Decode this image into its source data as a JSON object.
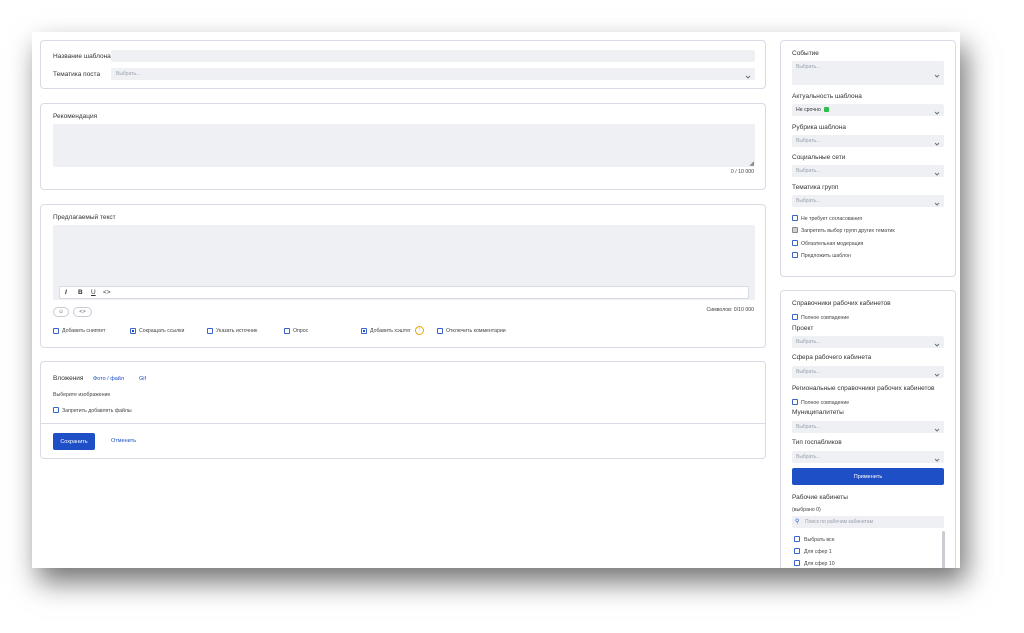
{
  "template": {
    "name_label": "Название шаблона",
    "topic_label": "Тематика поста",
    "topic_placeholder": "Выбрать..."
  },
  "recommendation": {
    "label": "Рекомендация",
    "counter": "0 / 10 000"
  },
  "proposed": {
    "label": "Предлагаемый текст",
    "toolbar": {
      "italic": "I",
      "bold": "B",
      "underline": "U",
      "code": "<>"
    },
    "emoji_btn": "☺",
    "code_btn": "<>",
    "counter": "Символов: 0/10 000",
    "options": [
      {
        "label": "Добавить сниппет",
        "checked": false
      },
      {
        "label": "Сокращать ссылки",
        "checked": true
      },
      {
        "label": "Указать источник",
        "checked": false
      },
      {
        "label": "Опрос",
        "checked": false
      },
      {
        "label": "Добавить хэштег",
        "checked": true
      },
      {
        "label": "Отключить комментарии",
        "checked": false
      }
    ]
  },
  "attachments": {
    "label": "Вложения",
    "photo_link": "Фото / файл",
    "gif_link": "Gif",
    "choose_image": "Выберите изображение",
    "forbid_files": "Запретить добавлять файлы",
    "save": "Сохранить",
    "cancel": "Отменить"
  },
  "right_top": {
    "event_label": "Событие",
    "event_placeholder": "Выбрать...",
    "actuality_label": "Актуальность шаблона",
    "actuality_value": "Не срочно",
    "actuality_color": "#2fbf4a",
    "rubric_label": "Рубрика шаблона",
    "rubric_placeholder": "Выбрать...",
    "social_label": "Социальные сети",
    "social_placeholder": "Выбрать...",
    "groups_label": "Тематика групп",
    "groups_placeholder": "Выбрать...",
    "checks": [
      {
        "label": "Не требует согласования",
        "state": "off"
      },
      {
        "label": "Запретить выбор групп других тематик",
        "state": "grey"
      },
      {
        "label": "Обязательная модерация",
        "state": "off"
      },
      {
        "label": "Предложить шаблон",
        "state": "off"
      }
    ]
  },
  "right_bottom": {
    "title": "Справочники рабочих кабинетов",
    "full_match": "Полное совпадение",
    "project_label": "Проект",
    "project_placeholder": "Выбрать...",
    "sphere_label": "Сфера рабочего кабинета",
    "sphere_placeholder": "Выбрать...",
    "regional_label": "Региональные справочники рабочих кабинетов",
    "full_match2": "Полное совпадение",
    "municipal_label": "Муниципалитеты",
    "municipal_placeholder": "Выбрать...",
    "type_label": "Тип госпабликов",
    "type_placeholder": "Выбрать...",
    "apply": "Применить",
    "cabinets_label": "Рабочие кабинеты",
    "selected": "(выбрано 0)",
    "search_placeholder": "Поиск по рабочим кабинетам",
    "select_all": "Выбрать все",
    "items": [
      "Для сфер 1",
      "Для сфер 10"
    ]
  },
  "colors": {
    "accent": "#1e4fc7",
    "border": "#d7dbe3",
    "field": "#eef0f4",
    "warning": "#f0a500"
  }
}
